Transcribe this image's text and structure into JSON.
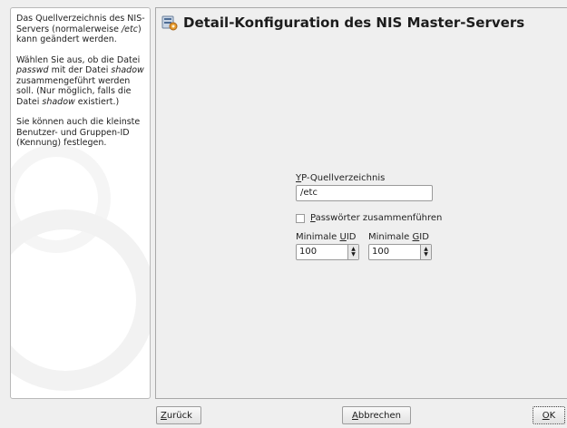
{
  "help": {
    "p1_a": "Das Quellverzeichnis des NIS-Servers (normalerweise ",
    "p1_em": "/etc",
    "p1_b": ") kann geändert werden.",
    "p2_a": "Wählen Sie aus, ob die Datei ",
    "p2_em1": "passwd",
    "p2_b": " mit der Datei ",
    "p2_em2": "shadow",
    "p2_c": " zusammengeführt werden soll. (Nur möglich, falls die Datei ",
    "p2_em3": "shadow",
    "p2_d": " existiert.)",
    "p3": "Sie können auch die kleinste Benutzer- und Gruppen-ID (Kennung) festlegen."
  },
  "header": {
    "title": "Detail-Konfiguration des NIS Master-Servers",
    "icon": "server-config-icon"
  },
  "form": {
    "source_dir_label_mnemonic": "Y",
    "source_dir_label_rest": "P-Quellverzeichnis",
    "source_dir_value": "/etc",
    "merge_label_mnemonic": "P",
    "merge_label_rest": "asswörter zusammenführen",
    "merge_checked": false,
    "min_uid_label_pre": "Minimale ",
    "min_uid_label_mnemonic": "U",
    "min_uid_label_post": "ID",
    "min_uid_value": "100",
    "min_gid_label_pre": "Minimale ",
    "min_gid_label_mnemonic": "G",
    "min_gid_label_post": "ID",
    "min_gid_value": "100"
  },
  "buttons": {
    "back_mnemonic": "Z",
    "back_rest": "urück",
    "cancel_mnemonic": "A",
    "cancel_rest": "bbrechen",
    "ok_mnemonic": "O",
    "ok_rest": "K"
  },
  "colors": {
    "background": "#efefef",
    "help_background": "#ffffff",
    "border": "#a8a8a8"
  }
}
